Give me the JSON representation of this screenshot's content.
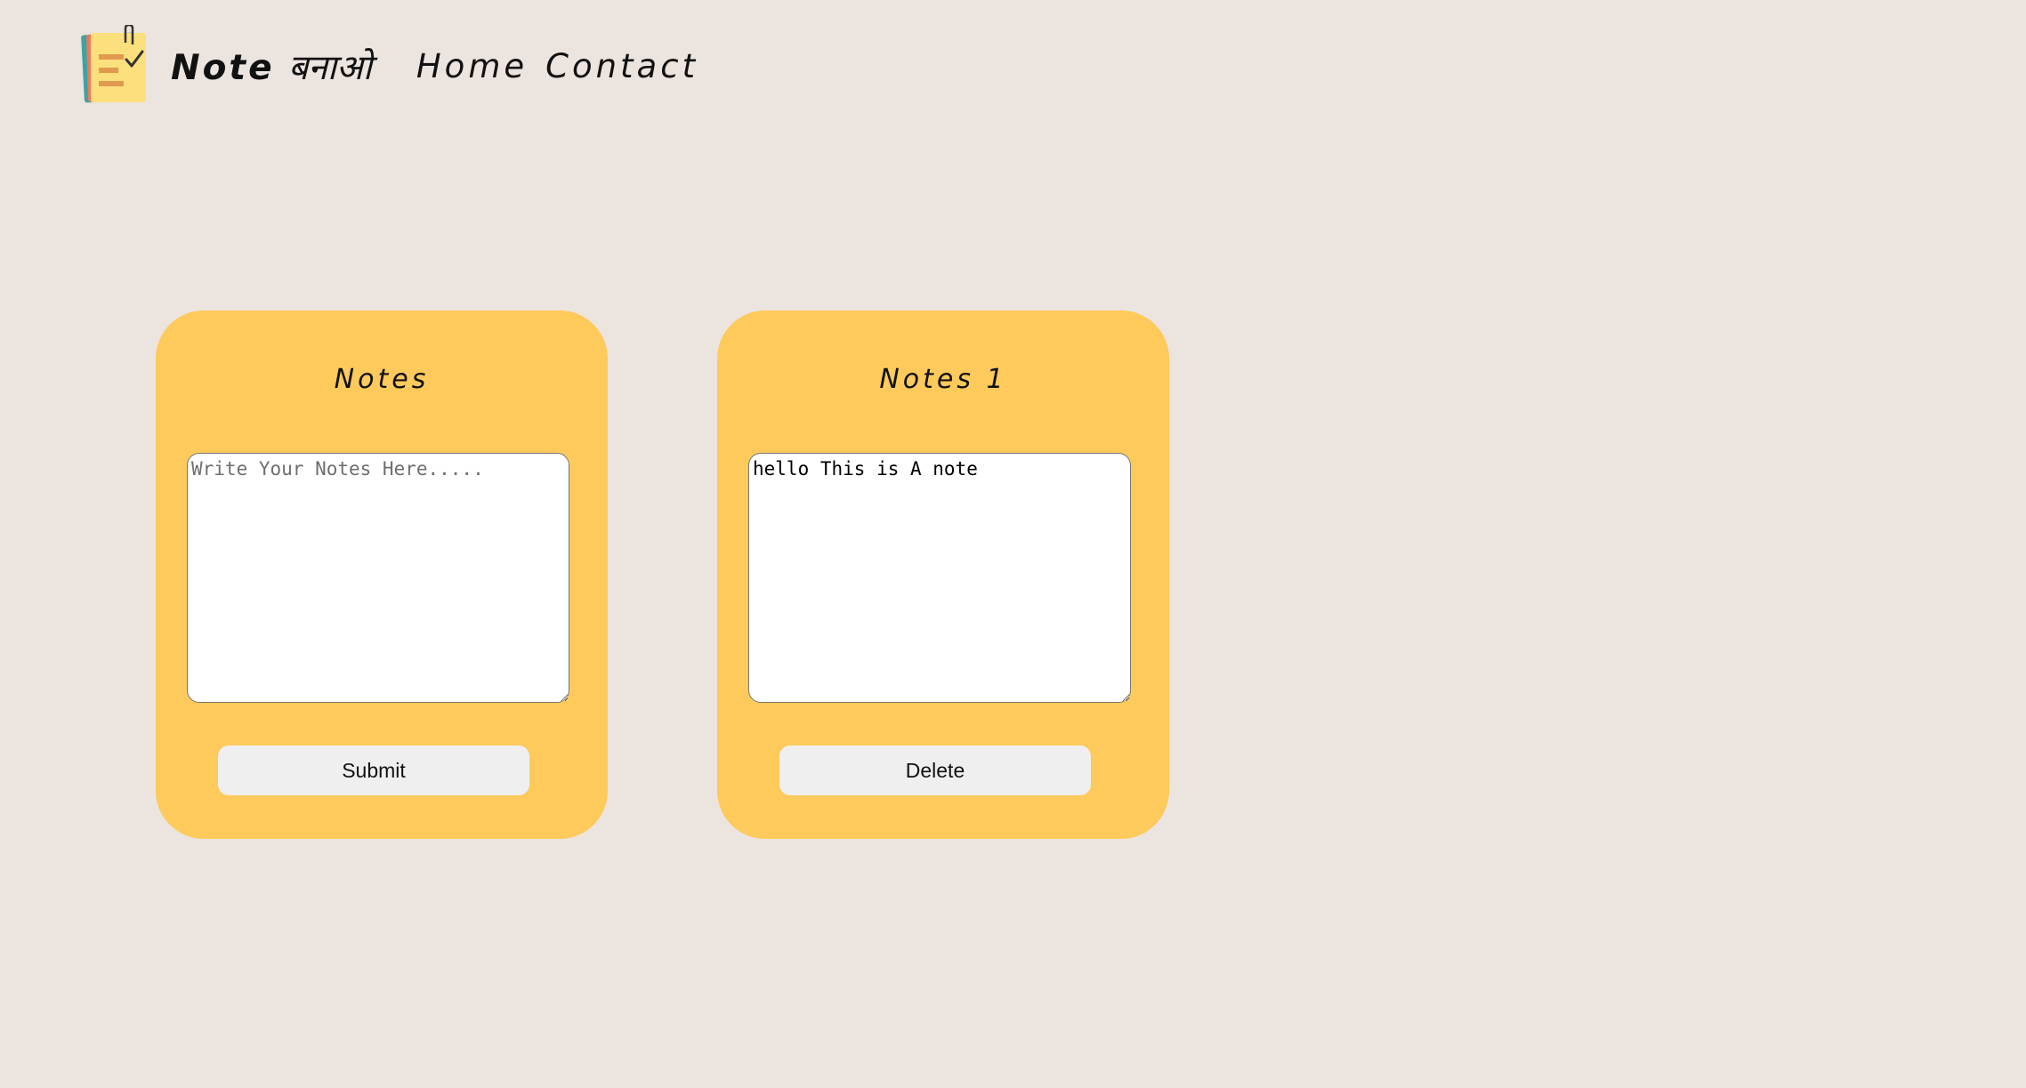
{
  "header": {
    "brand_name": "Note",
    "brand_suffix": "बनाओ",
    "nav": {
      "home_label": "Home",
      "contact_label": "Contact"
    },
    "logo_icon": "sticky-note-checklist-icon"
  },
  "cards": [
    {
      "title": "Notes",
      "textarea_value": "",
      "textarea_placeholder": "Write Your Notes Here.....",
      "button_label": "Submit"
    },
    {
      "title": "Notes 1",
      "textarea_value": "hello This is A note",
      "button_label": "Delete"
    }
  ],
  "colors": {
    "background": "#ece4df",
    "card": "#fdca5b",
    "button": "#efefef"
  }
}
